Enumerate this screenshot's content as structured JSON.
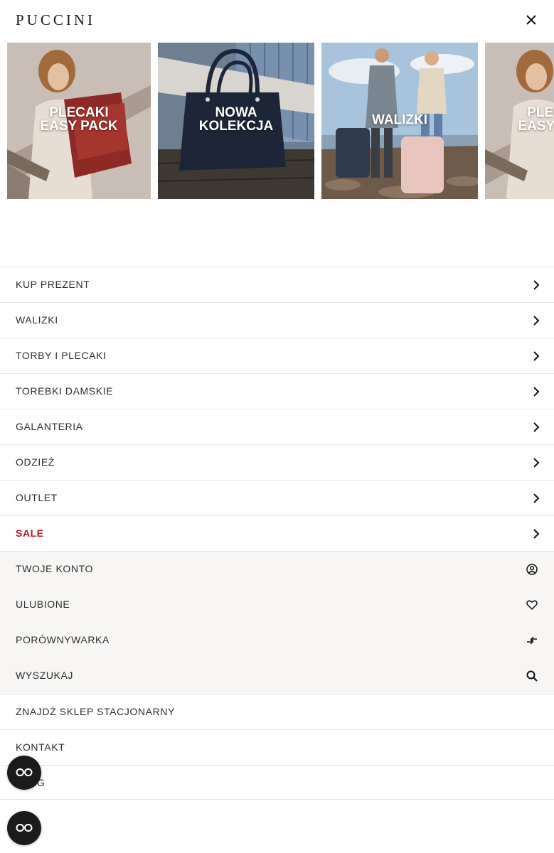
{
  "header": {
    "logo": "PUCCINI",
    "close_icon": "close-icon"
  },
  "banners": [
    {
      "label": "PLECAKI\nEASY PACK"
    },
    {
      "label": "NOWA\nKOLEKCJA"
    },
    {
      "label": "WALIZKI"
    },
    {
      "label": "PLECAKI\nEASY PACK"
    }
  ],
  "menu": {
    "items": [
      {
        "label": "KUP PREZENT"
      },
      {
        "label": "WALIZKI"
      },
      {
        "label": "TORBY I PLECAKI"
      },
      {
        "label": "TOREBKI DAMSKIE"
      },
      {
        "label": "GALANTERIA"
      },
      {
        "label": "ODZIEŻ"
      },
      {
        "label": "OUTLET"
      },
      {
        "label": "SALE",
        "color": "#c0131a"
      }
    ]
  },
  "account": {
    "items": [
      {
        "label": "TWOJE KONTO",
        "icon": "user-icon"
      },
      {
        "label": "ULUBIONE",
        "icon": "heart-icon"
      },
      {
        "label": "PORÓWNYWARKA",
        "icon": "compare-icon"
      },
      {
        "label": "WYSZUKAJ",
        "icon": "search-icon"
      }
    ]
  },
  "links": {
    "items": [
      {
        "label": "ZNAJDŹ SKLEP STACJONARNY"
      },
      {
        "label": "KONTAKT"
      },
      {
        "label": "BLOG"
      }
    ]
  },
  "colors": {
    "sale": "#c0131a",
    "account_bg": "#f7f6f4",
    "fab": "#1b1b1b"
  }
}
